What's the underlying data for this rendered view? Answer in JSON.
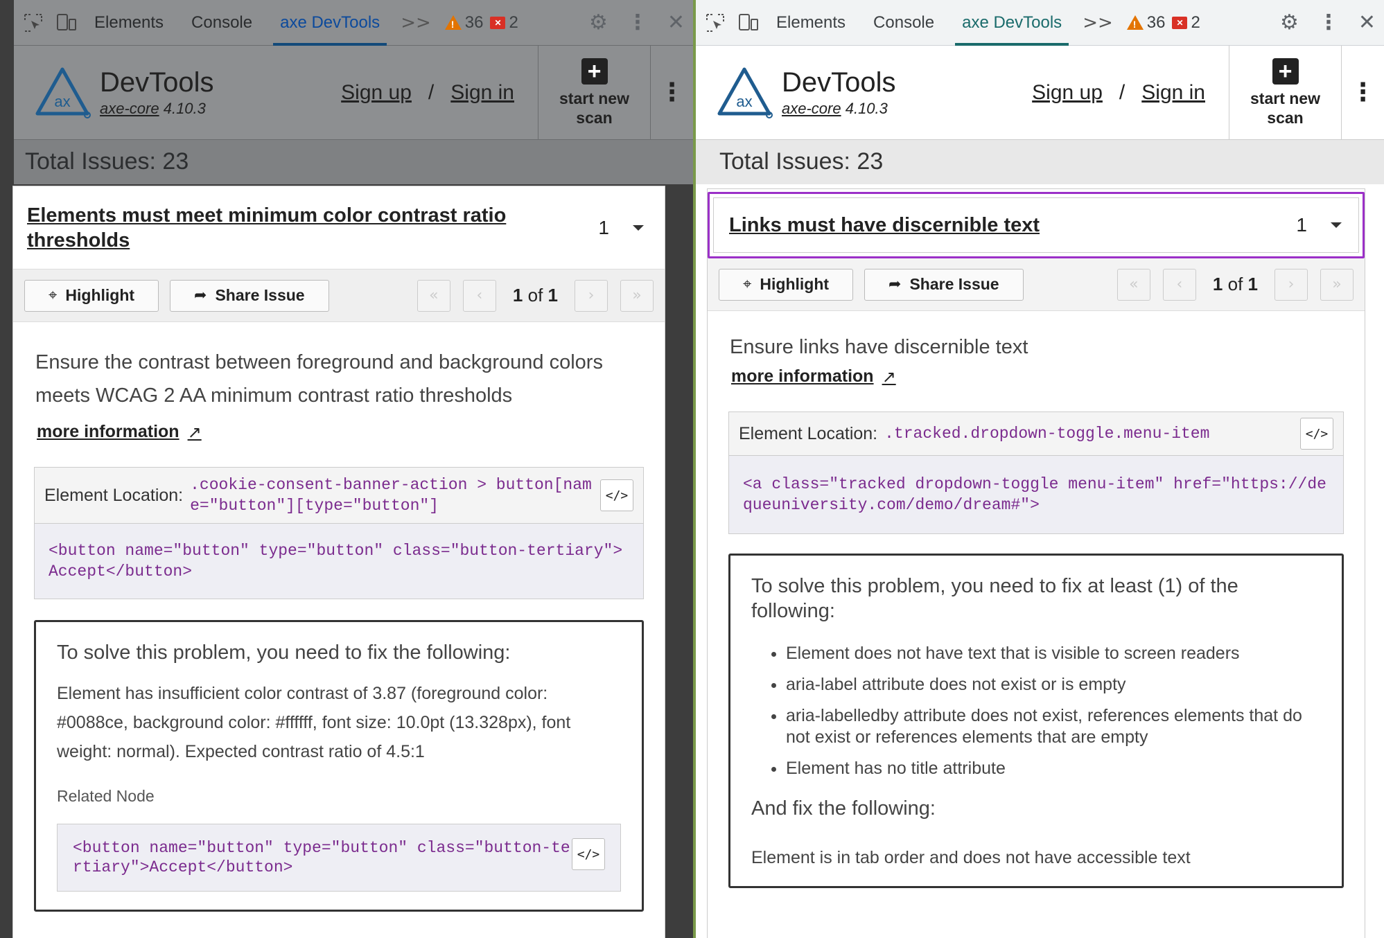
{
  "tabs": {
    "elements": "Elements",
    "console": "Console",
    "axe": "axe DevTools",
    "more": ">>",
    "warnings": "36",
    "errors": "2"
  },
  "header": {
    "title": "DevTools",
    "axe_core": "axe-core",
    "version": "4.10.3",
    "sign_up": "Sign up",
    "separator": "/",
    "sign_in": "Sign in",
    "scan_line1": "start new",
    "scan_line2": "scan"
  },
  "total_issues": "Total Issues: 23",
  "toolbar": {
    "highlight": "Highlight",
    "share": "Share Issue",
    "page_current": "1",
    "page_of": "of",
    "page_total": "1"
  },
  "left": {
    "rule_title": "Elements must meet minimum color contrast ratio thresholds",
    "rule_count": "1",
    "description": "Ensure the contrast between foreground and background colors meets WCAG 2 AA minimum contrast ratio thresholds",
    "more_info": "more information",
    "location_label": "Element Location:",
    "location_selector": ".cookie-consent-banner-action > button[name=\"button\"][type=\"button\"]",
    "snippet": "<button name=\"button\" type=\"button\" class=\"button-tertiary\">Accept</button>",
    "solve_heading": "To solve this problem, you need to fix the following:",
    "solve_detail": "Element has insufficient color contrast of 3.87 (foreground color: #0088ce, background color: #ffffff, font size: 10.0pt (13.328px), font weight: normal). Expected contrast ratio of 4.5:1",
    "related_label": "Related Node",
    "related_snippet": "<button name=\"button\" type=\"button\" class=\"button-tertiary\">Accept</button>"
  },
  "right": {
    "rule_title": "Links must have discernible text",
    "rule_count": "1",
    "description": "Ensure links have discernible text",
    "more_info": "more information",
    "location_label": "Element Location:",
    "location_selector": ".tracked.dropdown-toggle.menu-item",
    "snippet": "<a class=\"tracked dropdown-toggle menu-item\" href=\"https://dequeuniversity.com/demo/dream#\">",
    "solve_heading": "To solve this problem, you need to fix at least (1) of the following:",
    "solve_items": [
      "Element does not have text that is visible to screen readers",
      "aria-label attribute does not exist or is empty",
      "aria-labelledby attribute does not exist, references elements that do not exist or references elements that are empty",
      "Element has no title attribute"
    ],
    "and_fix": "And fix the following:",
    "and_fix_detail": "Element is in tab order and does not have accessible text"
  },
  "colors": {
    "highlight_border": "#9b30c8",
    "code_text": "#7b2b8e",
    "active_tab": "#1a6b6b"
  },
  "icons": [
    "inspect-icon",
    "device-toggle-icon",
    "warning-icon",
    "error-icon",
    "gear-icon",
    "kebab-icon",
    "close-icon",
    "axe-logo-icon",
    "add-scan-icon",
    "crosshair-icon",
    "share-icon",
    "first-page-icon",
    "prev-page-icon",
    "next-page-icon",
    "last-page-icon",
    "external-link-icon",
    "code-icon",
    "caret-down-icon"
  ]
}
